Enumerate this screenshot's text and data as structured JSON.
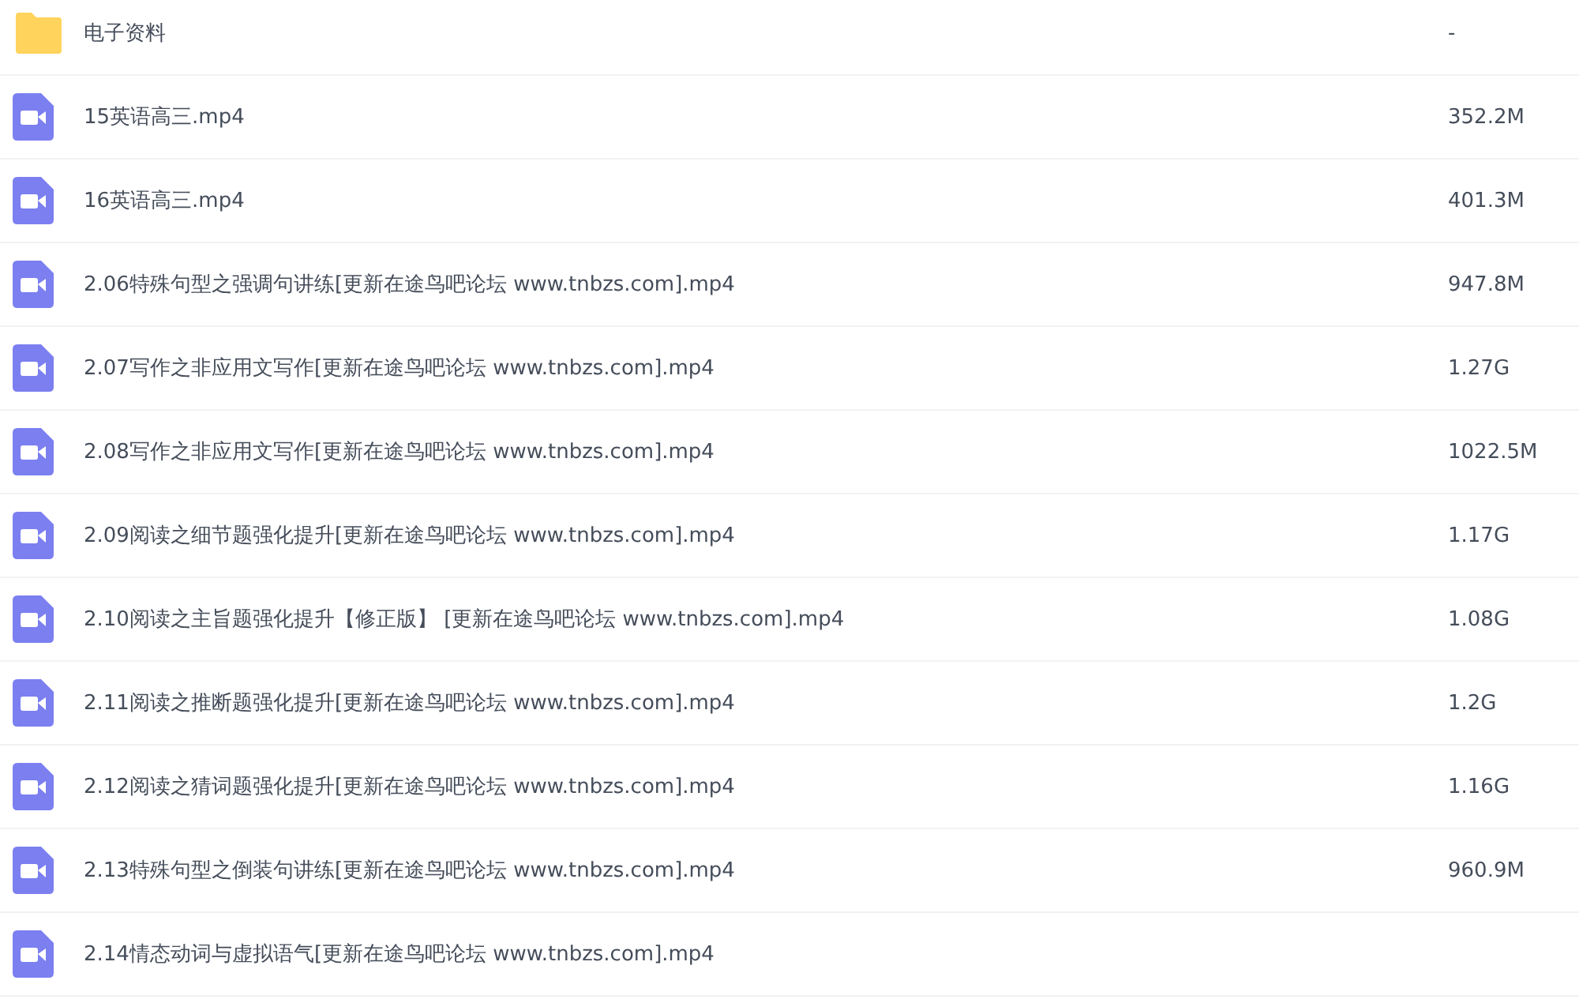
{
  "files": [
    {
      "kind": "folder",
      "name": "电子资料",
      "size": "-"
    },
    {
      "kind": "video",
      "name": "15英语高三.mp4",
      "size": "352.2M"
    },
    {
      "kind": "video",
      "name": "16英语高三.mp4",
      "size": "401.3M"
    },
    {
      "kind": "video",
      "name": "2.06特殊句型之强调句讲练[更新在途鸟吧论坛 www.tnbzs.com].mp4",
      "size": "947.8M"
    },
    {
      "kind": "video",
      "name": "2.07写作之非应用文写作[更新在途鸟吧论坛 www.tnbzs.com].mp4",
      "size": "1.27G"
    },
    {
      "kind": "video",
      "name": "2.08写作之非应用文写作[更新在途鸟吧论坛 www.tnbzs.com].mp4",
      "size": "1022.5M"
    },
    {
      "kind": "video",
      "name": "2.09阅读之细节题强化提升[更新在途鸟吧论坛 www.tnbzs.com].mp4",
      "size": "1.17G"
    },
    {
      "kind": "video",
      "name": "2.10阅读之主旨题强化提升【修正版】 [更新在途鸟吧论坛 www.tnbzs.com].mp4",
      "size": "1.08G"
    },
    {
      "kind": "video",
      "name": "2.11阅读之推断题强化提升[更新在途鸟吧论坛 www.tnbzs.com].mp4",
      "size": "1.2G"
    },
    {
      "kind": "video",
      "name": "2.12阅读之猜词题强化提升[更新在途鸟吧论坛 www.tnbzs.com].mp4",
      "size": "1.16G"
    },
    {
      "kind": "video",
      "name": "2.13特殊句型之倒装句讲练[更新在途鸟吧论坛 www.tnbzs.com].mp4",
      "size": "960.9M"
    },
    {
      "kind": "video",
      "name": "2.14情态动词与虚拟语气[更新在途鸟吧论坛 www.tnbzs.com].mp4"
    }
  ]
}
